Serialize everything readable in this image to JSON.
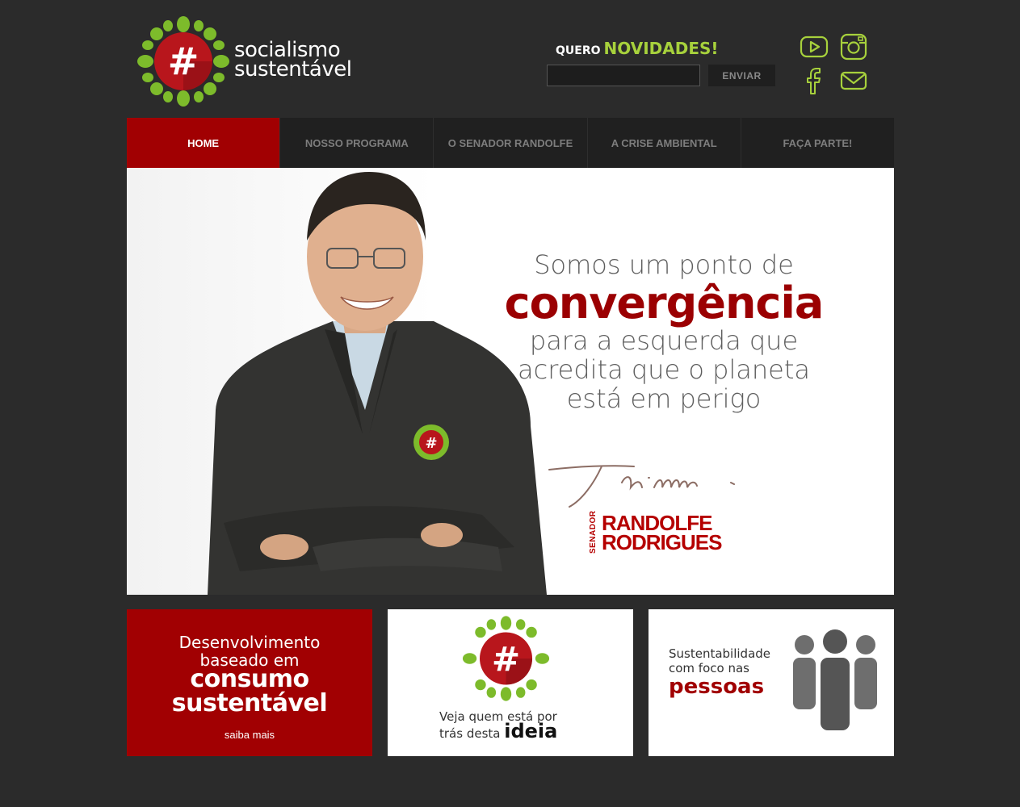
{
  "logo": {
    "line1": "socialismo",
    "line2": "sustentável"
  },
  "newsletter": {
    "prefix": "QUERO",
    "title": "NOVIDADES!",
    "input_value": "",
    "button": "ENVIAR"
  },
  "social": [
    "youtube-icon",
    "instagram-icon",
    "facebook-icon",
    "email-icon"
  ],
  "colors": {
    "brand_red": "#a10002",
    "accent_green": "#a7d13c",
    "background": "#2b2b2b"
  },
  "nav": [
    "HOME",
    "NOSSO PROGRAMA",
    "O SENADOR RANDOLFE",
    "A CRISE AMBIENTAL",
    "FAÇA PARTE!"
  ],
  "hero": {
    "line1": "Somos um ponto de",
    "highlight": "convergência",
    "line3": "para a esquerda que",
    "line4": "acredita que o planeta",
    "line5": "está em perigo",
    "signature_title": "SENADOR",
    "signature_first": "RANDOLFE",
    "signature_last": "RODRIGUES"
  },
  "cards": {
    "red": {
      "line1": "Desenvolvimento",
      "line2": "baseado em",
      "line3": "consumo",
      "line4": "sustentável",
      "more": "saiba mais"
    },
    "middle": {
      "line1": "Veja quem está por",
      "line2": "trás desta",
      "highlight": "ideia"
    },
    "right": {
      "line1": "Sustentabilidade",
      "line2": "com foco nas",
      "highlight": "pessoas"
    }
  }
}
